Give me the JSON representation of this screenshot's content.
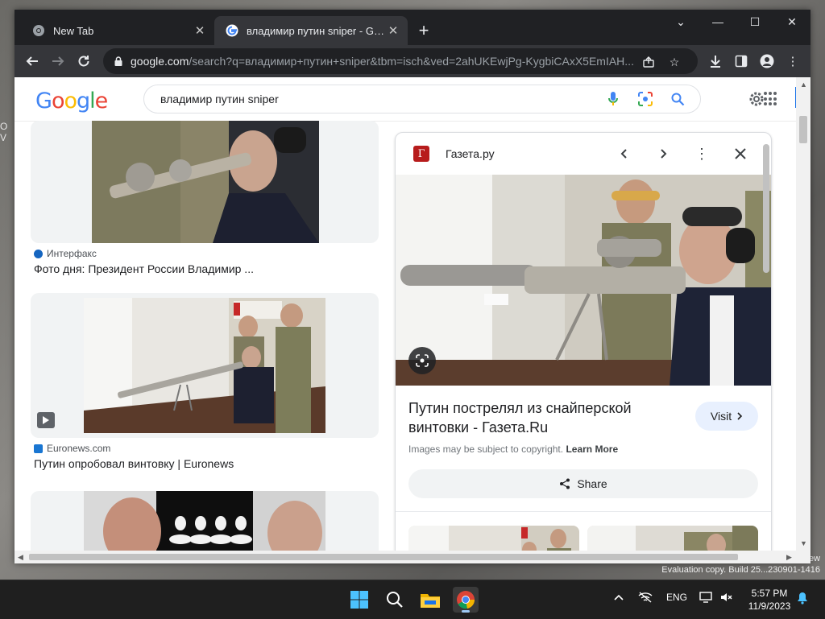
{
  "desktop": {
    "side_text": "O\nV",
    "watermark_line1": "ew",
    "watermark_line2": "Evaluation copy. Build 25...230901-1416"
  },
  "browser": {
    "tabs": [
      {
        "title": "New Tab",
        "active": false
      },
      {
        "title": "владимир путин sniper - Google",
        "active": true
      }
    ],
    "url_domain": "google.com",
    "url_rest": "/search?q=владимир+путин+sniper&tbm=isch&ved=2ahUKEwjPg-KygbiCAxX5EmIAH...",
    "window_controls": {
      "dropdown": "⌄",
      "minimize": "—",
      "maximize": "☐",
      "close": "✕"
    }
  },
  "google": {
    "logo": [
      "G",
      "o",
      "o",
      "g",
      "l",
      "e"
    ],
    "logo_colors": [
      "#4285F4",
      "#EA4335",
      "#FBBC05",
      "#4285F4",
      "#34A853",
      "#EA4335"
    ],
    "query": "владимир путин  sniper"
  },
  "results": [
    {
      "source": "Интерфакс",
      "title": "Фото дня: Президент России Владимир ...",
      "source_color": "#1565c0"
    },
    {
      "source": "Euronews.com",
      "title": "Путин опробовал винтовку | Euronews",
      "source_color": "#1976d2"
    }
  ],
  "panel": {
    "site": "Газета.ру",
    "site_initial": "Г",
    "title": "Путин пострелял из снайперской винтовки - Газета.Ru",
    "visit_label": "Visit",
    "copyright": "Images may be subject to copyright.",
    "learn_more": "Learn More",
    "share_label": "Share"
  },
  "taskbar": {
    "lang": "ENG",
    "time": "5:57 PM",
    "date": "11/9/2023"
  }
}
